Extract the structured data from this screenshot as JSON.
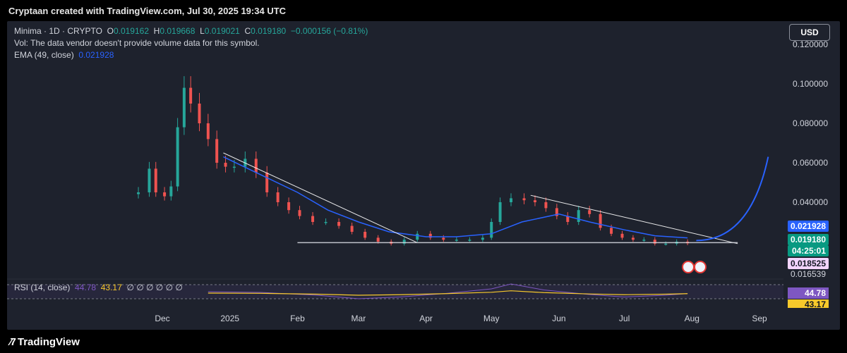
{
  "header": {
    "text": "Cryptaan created with TradingView.com, Jul 30, 2025 19:34 UTC"
  },
  "legend": {
    "symbol": "Minima · 1D · CRYPTO",
    "o_label": "O",
    "o": "0.019162",
    "h_label": "H",
    "h": "0.019668",
    "l_label": "L",
    "l": "0.019021",
    "c_label": "C",
    "c": "0.019180",
    "change": "−0.000156 (−0.81%)",
    "vol_line": "Vol: The data vendor doesn't provide volume data for this symbol.",
    "ema_label": "EMA (49, close)",
    "ema_value": "0.021928"
  },
  "currency_button": "USD",
  "rsi": {
    "label": "RSI (14, close)",
    "value1": "44.78",
    "value2": "43.17",
    "zeros": "∅ ∅ ∅ ∅ ∅ ∅"
  },
  "footer": {
    "brand": "TradingView"
  },
  "colors": {
    "up": "#26a69a",
    "down": "#ef5350",
    "ema": "#2962ff",
    "rsi": "#7e57c2",
    "rsi_ma": "#f7c92b",
    "projection": "#2962ff",
    "trendline": "#ffffff"
  },
  "chart_data": {
    "type": "line",
    "title": "Minima · 1D · CRYPTO",
    "xlabel": "",
    "ylabel": "",
    "x_ticks": [
      "Dec",
      "2025",
      "Feb",
      "Mar",
      "Apr",
      "May",
      "Jun",
      "Jul",
      "Aug",
      "Sep"
    ],
    "x_tick_dates": [
      "2024-12-01",
      "2025-01-01",
      "2025-02-01",
      "2025-03-01",
      "2025-04-01",
      "2025-05-01",
      "2025-06-01",
      "2025-07-01",
      "2025-08-01",
      "2025-09-01"
    ],
    "y_ticks": [
      "0.120000",
      "0.100000",
      "0.080000",
      "0.060000",
      "0.040000"
    ],
    "y_tick_values": [
      0.12,
      0.1,
      0.08,
      0.06,
      0.04
    ],
    "ylim": [
      0.0145,
      0.1235
    ],
    "price_labels": [
      {
        "text": "0.021928",
        "value": 0.021928,
        "kind": "ema"
      },
      {
        "text": "0.019180",
        "value": 0.01918,
        "kind": "last"
      },
      {
        "text": "04:25:01",
        "value": null,
        "kind": "countdown"
      },
      {
        "text": "0.018525",
        "value": 0.018525,
        "kind": "level"
      },
      {
        "text": "0.016539",
        "value": 0.016539,
        "kind": "axis"
      }
    ],
    "series": [
      {
        "name": "Minima",
        "type": "candlestick-approx (close)",
        "x": [
          "2024-11-20",
          "2024-11-25",
          "2024-11-28",
          "2024-12-02",
          "2024-12-05",
          "2024-12-08",
          "2024-12-11",
          "2024-12-14",
          "2024-12-18",
          "2024-12-22",
          "2024-12-26",
          "2024-12-30",
          "2025-01-03",
          "2025-01-08",
          "2025-01-13",
          "2025-01-18",
          "2025-01-23",
          "2025-01-28",
          "2025-02-02",
          "2025-02-08",
          "2025-02-14",
          "2025-02-20",
          "2025-02-26",
          "2025-03-04",
          "2025-03-10",
          "2025-03-16",
          "2025-03-22",
          "2025-03-28",
          "2025-04-03",
          "2025-04-09",
          "2025-04-15",
          "2025-04-21",
          "2025-04-27",
          "2025-05-01",
          "2025-05-05",
          "2025-05-10",
          "2025-05-16",
          "2025-05-21",
          "2025-05-26",
          "2025-05-31",
          "2025-06-05",
          "2025-06-10",
          "2025-06-15",
          "2025-06-20",
          "2025-06-25",
          "2025-06-30",
          "2025-07-05",
          "2025-07-10",
          "2025-07-15",
          "2025-07-20",
          "2025-07-25",
          "2025-07-30"
        ],
        "values": [
          0.045,
          0.057,
          0.045,
          0.043,
          0.048,
          0.078,
          0.098,
          0.09,
          0.08,
          0.072,
          0.06,
          0.058,
          0.058,
          0.062,
          0.055,
          0.045,
          0.04,
          0.036,
          0.033,
          0.03,
          0.03,
          0.028,
          0.025,
          0.022,
          0.02,
          0.019,
          0.021,
          0.024,
          0.022,
          0.021,
          0.021,
          0.021,
          0.022,
          0.03,
          0.04,
          0.042,
          0.041,
          0.04,
          0.037,
          0.033,
          0.03,
          0.036,
          0.034,
          0.027,
          0.024,
          0.022,
          0.021,
          0.021,
          0.019,
          0.019,
          0.02,
          0.01918
        ]
      },
      {
        "name": "EMA (49, close)",
        "x": [
          "2024-12-29",
          "2025-01-15",
          "2025-02-01",
          "2025-02-15",
          "2025-03-01",
          "2025-03-15",
          "2025-04-01",
          "2025-04-15",
          "2025-05-01",
          "2025-05-15",
          "2025-06-01",
          "2025-06-15",
          "2025-07-01",
          "2025-07-15",
          "2025-07-30"
        ],
        "values": [
          0.063,
          0.054,
          0.045,
          0.036,
          0.03,
          0.025,
          0.0225,
          0.0225,
          0.024,
          0.03,
          0.034,
          0.03,
          0.026,
          0.023,
          0.021928
        ]
      },
      {
        "name": "RSI (14, close)",
        "x": [
          "2024-12-22",
          "2025-01-15",
          "2025-02-10",
          "2025-03-01",
          "2025-03-20",
          "2025-04-10",
          "2025-05-01",
          "2025-05-10",
          "2025-05-25",
          "2025-06-15",
          "2025-07-01",
          "2025-07-20",
          "2025-07-30"
        ],
        "values": [
          50,
          48,
          40,
          30,
          35,
          45,
          58,
          72,
          55,
          42,
          35,
          40,
          44.78
        ]
      }
    ],
    "annotations": [
      {
        "type": "trendline",
        "from": {
          "x": "2024-12-29",
          "y": 0.065
        },
        "to": {
          "x": "2025-03-28",
          "y": 0.0195
        }
      },
      {
        "type": "trendline",
        "from": {
          "x": "2025-05-19",
          "y": 0.0435
        },
        "to": {
          "x": "2025-08-22",
          "y": 0.019
        }
      },
      {
        "type": "horizontal",
        "from": {
          "x": "2025-02-01",
          "y": 0.0195
        },
        "to": {
          "x": "2025-08-22",
          "y": 0.0195
        }
      },
      {
        "type": "projection-curve",
        "from": {
          "x": "2025-08-03",
          "y": 0.0206
        },
        "to": {
          "x": "2025-09-05",
          "y": 0.063
        }
      }
    ],
    "grid": false,
    "legend": "top-left"
  }
}
